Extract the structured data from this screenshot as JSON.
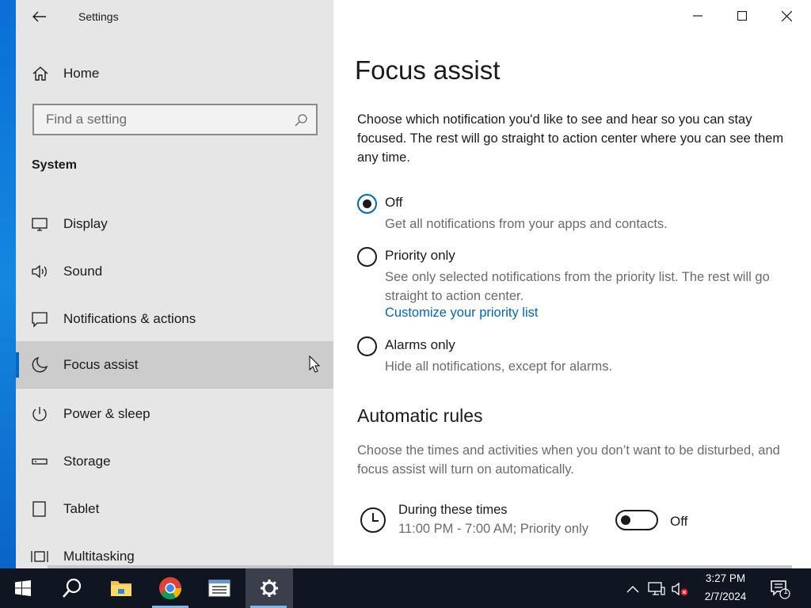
{
  "window": {
    "app_title": "Settings"
  },
  "sidebar": {
    "home_label": "Home",
    "search_placeholder": "Find a setting",
    "section_label": "System",
    "items": [
      {
        "label": "Display",
        "icon": "monitor-icon"
      },
      {
        "label": "Sound",
        "icon": "speaker-icon"
      },
      {
        "label": "Notifications & actions",
        "icon": "message-icon"
      },
      {
        "label": "Focus assist",
        "icon": "moon-icon",
        "selected": true
      },
      {
        "label": "Power & sleep",
        "icon": "power-icon"
      },
      {
        "label": "Storage",
        "icon": "drive-icon"
      },
      {
        "label": "Tablet",
        "icon": "tablet-icon"
      },
      {
        "label": "Multitasking",
        "icon": "multitasking-icon"
      }
    ]
  },
  "main": {
    "title": "Focus assist",
    "description": "Choose which notification you'd like to see and hear so you can stay focused. The rest will go straight to action center where you can see them any time.",
    "options": [
      {
        "label": "Off",
        "sub": "Get all notifications from your apps and contacts.",
        "checked": true
      },
      {
        "label": "Priority only",
        "sub": "See only selected notifications from the priority list. The rest will go straight to action center.",
        "link": "Customize your priority list",
        "checked": false
      },
      {
        "label": "Alarms only",
        "sub": "Hide all notifications, except for alarms.",
        "checked": false
      }
    ],
    "rules_heading": "Automatic rules",
    "rules_description": "Choose the times and activities when you don’t want to be disturbed, and focus assist will turn on automatically.",
    "rule": {
      "title": "During these times",
      "sub": "11:00 PM - 7:00 AM; Priority only",
      "toggle_state": "Off",
      "toggle_on": false
    }
  },
  "taskbar": {
    "time": "3:27 PM",
    "date": "2/7/2024",
    "notification_count": "1",
    "apps": [
      "start-icon",
      "search-icon",
      "file-explorer-icon",
      "chrome-icon",
      "notepad-icon",
      "settings-icon"
    ]
  },
  "colors": {
    "accent": "#0067c0",
    "link": "#0067b8",
    "sidebar_bg": "#e6e6e6",
    "selected_bg": "#cccccc",
    "taskbar_bg": "#101522"
  }
}
